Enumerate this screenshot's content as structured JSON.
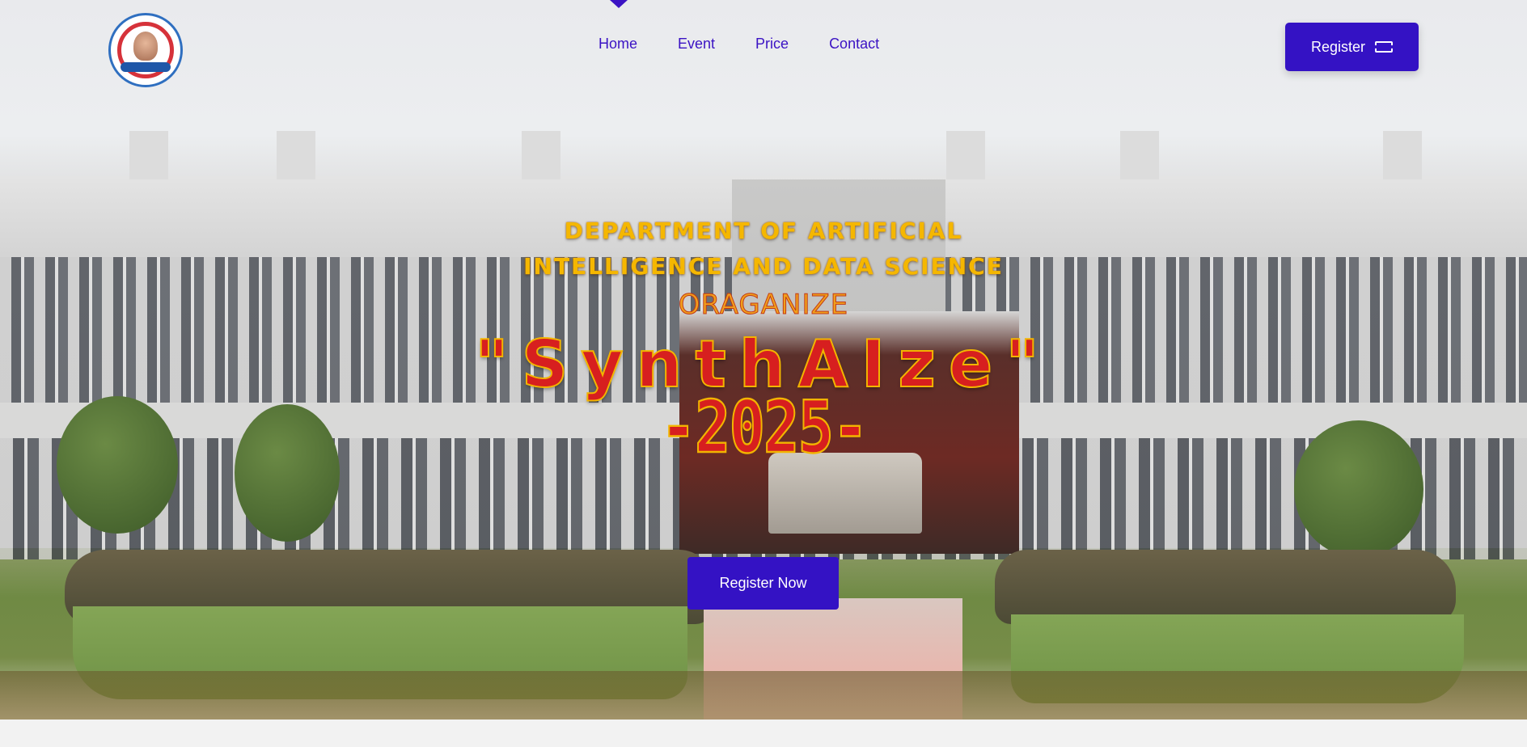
{
  "nav": {
    "logo_icon": "college-emblem-logo",
    "links": [
      {
        "label": "Home"
      },
      {
        "label": "Event"
      },
      {
        "label": "Price"
      },
      {
        "label": "Contact"
      }
    ],
    "active": "Home",
    "register_label": "Register",
    "register_icon": "ticket-icon"
  },
  "hero": {
    "department_line1": "DEPARTMENT OF ARTIFICIAL",
    "department_line2": "INTELLIGENCE AND DATA SCIENCE",
    "organize": "ORAGANIZE",
    "event_name": "\"SynthAIze\"",
    "year": "-2025-",
    "cta_label": "Register Now"
  },
  "colors": {
    "accent": "#3412c4",
    "title_gold": "#f5b700",
    "title_red": "#d71f1f"
  }
}
